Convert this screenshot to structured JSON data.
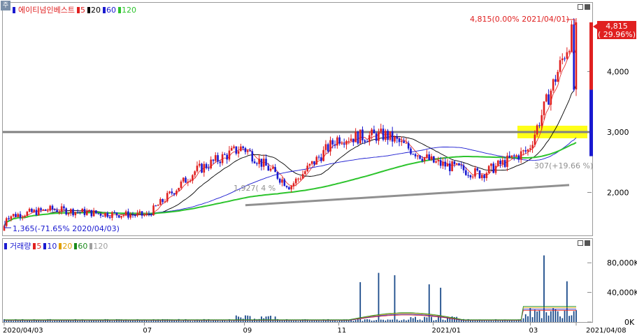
{
  "stock_name": "에이티넘인베스트",
  "price_legend": [
    {
      "label": "5",
      "color": "#e02020"
    },
    {
      "label": "20",
      "color": "#000000"
    },
    {
      "label": "60",
      "color": "#1a1ad0"
    },
    {
      "label": "120",
      "color": "#2dc42d"
    }
  ],
  "volume_legend_title": "거래량",
  "volume_legend": [
    {
      "label": "5",
      "color": "#e02020"
    },
    {
      "label": "10",
      "color": "#1a1ad0"
    },
    {
      "label": "20",
      "color": "#e0a000"
    },
    {
      "label": "60",
      "color": "#1a8a1a"
    },
    {
      "label": "120",
      "color": "#a0a0a0"
    }
  ],
  "corner_label": "주",
  "annotations": {
    "high": "4,815(0.00% 2021/04/01)",
    "low": "1,365(-71.65% 2020/04/03)",
    "mid_left": "1,927(   4 %",
    "mid_right": "307(+19.66 %)"
  },
  "price_badge": {
    "price": "4,815",
    "change": "( 29.96%)"
  },
  "chart_data": {
    "type": "candlestick",
    "title": "에이티넘인베스트",
    "x_ticks": [
      "2020/04/03",
      "07",
      "09",
      "11",
      "2021/01",
      "03",
      "2021/04/08"
    ],
    "price_axis": {
      "ticks": [
        "2,000",
        "3,000",
        "4,000"
      ],
      "ylim": [
        1300,
        5000
      ]
    },
    "volume_axis": {
      "ticks": [
        "0K",
        "40,000K",
        "80,000K"
      ],
      "ylim": [
        0,
        100000
      ]
    },
    "key_points": [
      {
        "date": "2020/04/03",
        "price": 1365,
        "label": "low"
      },
      {
        "date": "2021/04/01",
        "price": 4815,
        "label": "high"
      }
    ],
    "series_close_approx": [
      {
        "date": "2020-04",
        "close": 1600
      },
      {
        "date": "2020-05",
        "close": 1720
      },
      {
        "date": "2020-06",
        "close": 1650
      },
      {
        "date": "2020-07",
        "close": 1620
      },
      {
        "date": "2020-08",
        "close": 2350
      },
      {
        "date": "2020-09",
        "close": 2750
      },
      {
        "date": "2020-10",
        "close": 2100
      },
      {
        "date": "2020-11",
        "close": 2900
      },
      {
        "date": "2020-12",
        "close": 2950
      },
      {
        "date": "2021-01",
        "close": 2500
      },
      {
        "date": "2021-02",
        "close": 2300
      },
      {
        "date": "2021-03",
        "close": 2700
      },
      {
        "date": "2021-04",
        "close": 4815
      }
    ],
    "reference_lines": {
      "horizontal_support": 3000,
      "rising_trendline": {
        "from": {
          "date": "2020-09",
          "price": 1927
        },
        "to": {
          "date": "2021-03",
          "price": 2307
        }
      }
    },
    "moving_averages": [
      "5",
      "20",
      "60",
      "120"
    ]
  }
}
